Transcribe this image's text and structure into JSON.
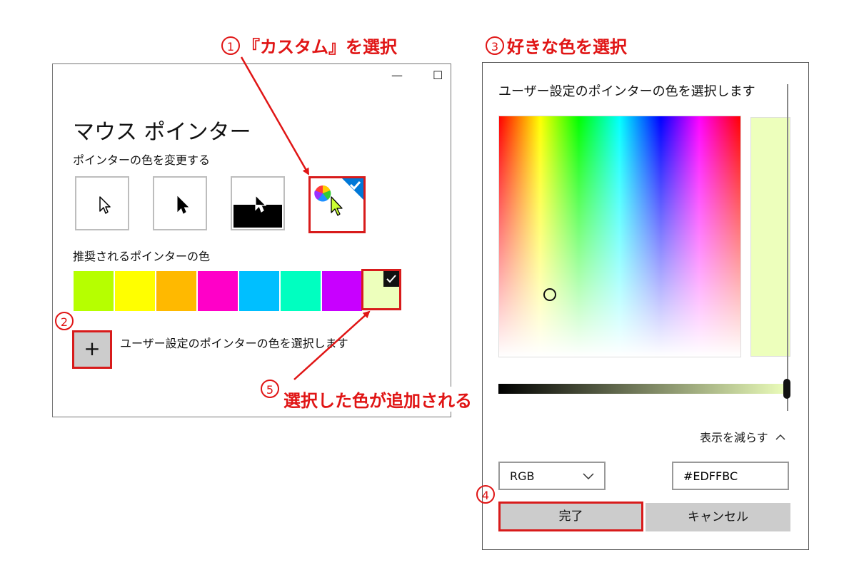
{
  "annotations": {
    "step1_num": "1",
    "step1_text": "『カスタム』を選択",
    "step2_num": "2",
    "step3_num": "3",
    "step3_text": "好きな色を選択",
    "step4_num": "4",
    "step5_num": "5",
    "step5_text": "選択した色が追加される"
  },
  "left_window": {
    "minimize_glyph": "—",
    "maximize_glyph": "☐",
    "title": "マウス ポインター",
    "change_color_label": "ポインターの色を変更する",
    "recommended_label": "推奨されるポインターの色",
    "custom_color_label": "ユーザー設定のポインターの色を選択します",
    "add_glyph": "+",
    "swatches": [
      "#b6ff00",
      "#ffff00",
      "#ffb900",
      "#ff00c8",
      "#00bfff",
      "#00ffc0",
      "#c800ff",
      "#edffbc"
    ],
    "selected_swatch_color": "#edffbc"
  },
  "right_window": {
    "title": "ユーザー設定のポインターの色を選択します",
    "preview_color": "#edffbc",
    "show_less_label": "表示を減らす",
    "color_mode_value": "RGB",
    "hex_value": "#EDFFBC",
    "done_label": "完了",
    "cancel_label": "キャンセル"
  },
  "colors": {
    "accent_red": "#e01515",
    "selection_blue": "#0078d7"
  }
}
